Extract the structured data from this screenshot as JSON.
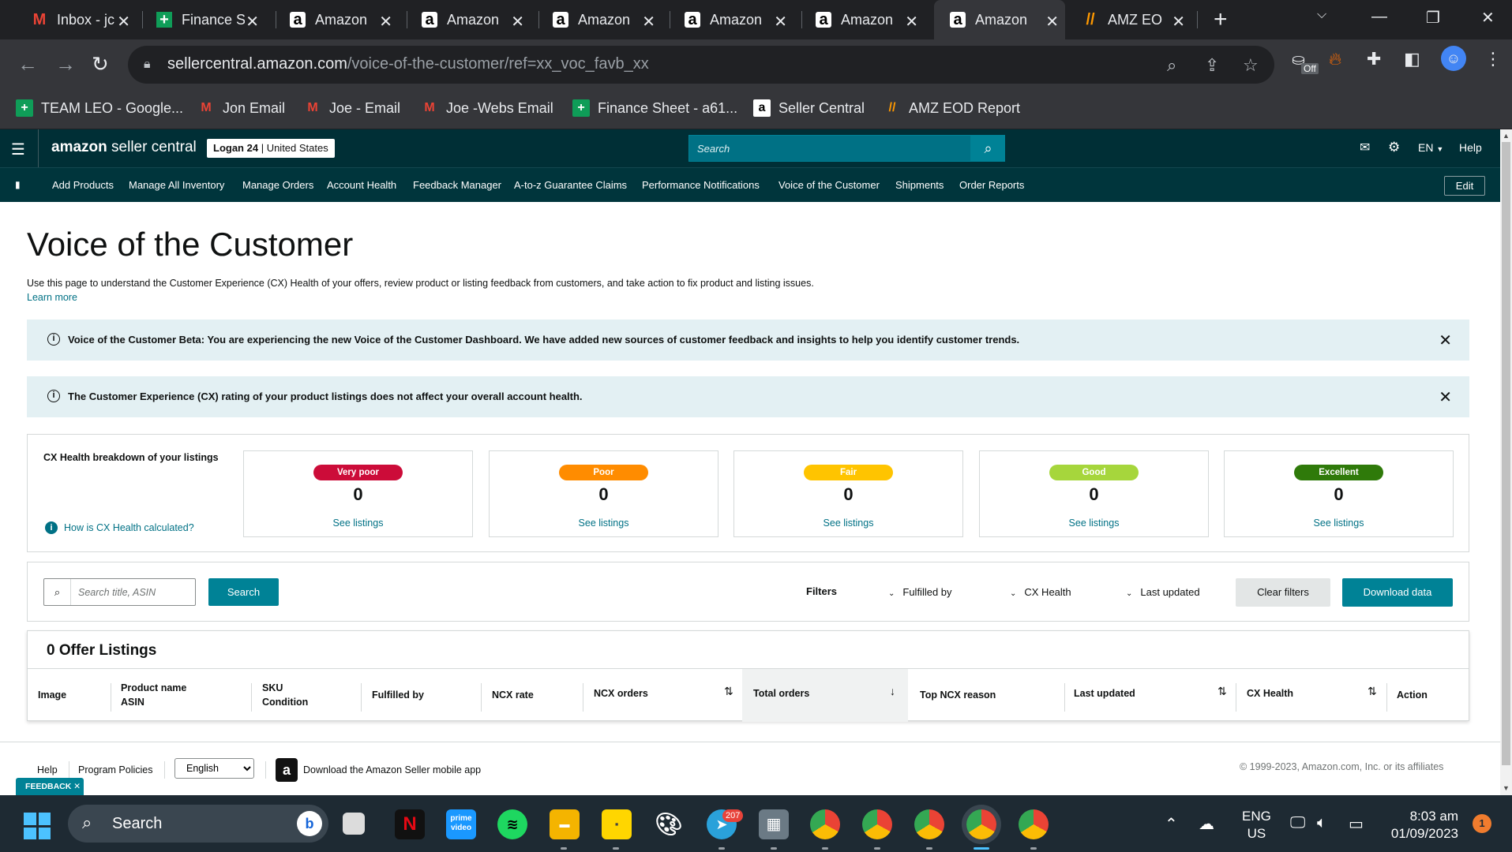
{
  "browser": {
    "tabs": [
      {
        "title": "Inbox - jc",
        "icon": "gmail-icon",
        "glyph": "M"
      },
      {
        "title": "Finance S",
        "icon": "sheets-icon",
        "glyph": "+"
      },
      {
        "title": "Amazon",
        "icon": "amazon-icon",
        "glyph": "a"
      },
      {
        "title": "Amazon",
        "icon": "amazon-icon",
        "glyph": "a"
      },
      {
        "title": "Amazon",
        "icon": "amazon-icon",
        "glyph": "a"
      },
      {
        "title": "Amazon",
        "icon": "amazon-icon",
        "glyph": "a"
      },
      {
        "title": "Amazon",
        "icon": "amazon-icon",
        "glyph": "a"
      },
      {
        "title": "Amazon",
        "icon": "amazon-icon",
        "glyph": "a"
      },
      {
        "title": "AMZ EOI",
        "icon": "amz-eod-icon",
        "glyph": "//"
      }
    ],
    "url_host": "sellercentral.amazon.com",
    "url_path": "/voice-of-the-customer/ref=xx_voc_favb_xx",
    "extension_badge": "Off",
    "bookmarks": [
      {
        "label": "TEAM LEO - Google...",
        "icon": "sheets-icon",
        "glyph": "+"
      },
      {
        "label": "Jon Email",
        "icon": "gmail-icon",
        "glyph": "M"
      },
      {
        "label": "Joe - Email",
        "icon": "gmail-icon",
        "glyph": "M"
      },
      {
        "label": "Joe -Webs Email",
        "icon": "gmail-icon",
        "glyph": "M"
      },
      {
        "label": "Finance Sheet - a61...",
        "icon": "sheets-icon",
        "glyph": "+"
      },
      {
        "label": "Seller Central",
        "icon": "amazon-icon",
        "glyph": "a"
      },
      {
        "label": "AMZ EOD Report",
        "icon": "amz-eod-icon",
        "glyph": "//"
      }
    ]
  },
  "sc": {
    "logo_a": "amazon",
    "logo_b": " seller central",
    "store_name": "Logan 24",
    "store_sep": " | ",
    "store_country": "United States",
    "search_placeholder": "Search",
    "lang": "EN",
    "help": "Help",
    "nav": [
      "Add Products",
      "Manage All Inventory",
      "Manage Orders",
      "Account Health",
      "Feedback Manager",
      "A-to-z Guarantee Claims",
      "Performance Notifications",
      "Voice of the Customer",
      "Shipments",
      "Order Reports"
    ],
    "edit": "Edit"
  },
  "page": {
    "title": "Voice of the Customer",
    "description": "Use this page to understand the Customer Experience (CX) Health of your offers, review product or listing feedback from customers, and take action to fix product and listing issues.",
    "learn_more": "Learn more",
    "alerts": [
      "Voice of the Customer Beta: You are experiencing the new Voice of the Customer Dashboard. We have added new sources of customer feedback and insights to help you identify customer trends.",
      "The Customer Experience (CX) rating of your product listings does not affect your overall account health."
    ],
    "cx": {
      "title": "CX Health breakdown of your listings",
      "how": "How is CX Health calculated?",
      "cards": [
        {
          "label": "Very poor",
          "count": "0",
          "link": "See listings",
          "color": "#cc0c39"
        },
        {
          "label": "Poor",
          "count": "0",
          "link": "See listings",
          "color": "#ff8c00"
        },
        {
          "label": "Fair",
          "count": "0",
          "link": "See listings",
          "color": "#ffc400"
        },
        {
          "label": "Good",
          "count": "0",
          "link": "See listings",
          "color": "#a6d63c"
        },
        {
          "label": "Excellent",
          "count": "0",
          "link": "See listings",
          "color": "#2f7a0a"
        }
      ]
    },
    "filters": {
      "search_placeholder": "Search title, ASIN",
      "search_button": "Search",
      "label": "Filters",
      "dropdowns": [
        "Fulfilled by",
        "CX Health",
        "Last updated"
      ],
      "clear": "Clear filters",
      "download": "Download data"
    },
    "listings": {
      "title": "0 Offer Listings",
      "columns": [
        {
          "l1": "Image",
          "l2": ""
        },
        {
          "l1": "Product name",
          "l2": "ASIN"
        },
        {
          "l1": "SKU",
          "l2": "Condition"
        },
        {
          "l1": "Fulfilled by",
          "l2": ""
        },
        {
          "l1": "NCX rate",
          "l2": ""
        },
        {
          "l1": "NCX orders",
          "l2": ""
        },
        {
          "l1": "Total orders",
          "l2": ""
        },
        {
          "l1": "Top NCX reason",
          "l2": ""
        },
        {
          "l1": "Last updated",
          "l2": ""
        },
        {
          "l1": "CX Health",
          "l2": ""
        },
        {
          "l1": "Action",
          "l2": ""
        }
      ]
    },
    "footer": {
      "help": "Help",
      "policies": "Program Policies",
      "language": "English",
      "app": "Download the Amazon Seller mobile app",
      "copyright": "© 1999-2023, Amazon.com, Inc. or its affiliates"
    },
    "feedback": "FEEDBACK"
  },
  "taskbar": {
    "search": "Search",
    "telegram_badge": "207",
    "lang_1": "ENG",
    "lang_2": "US",
    "time": "8:03 am",
    "date": "01/09/2023",
    "notifications": "1"
  }
}
